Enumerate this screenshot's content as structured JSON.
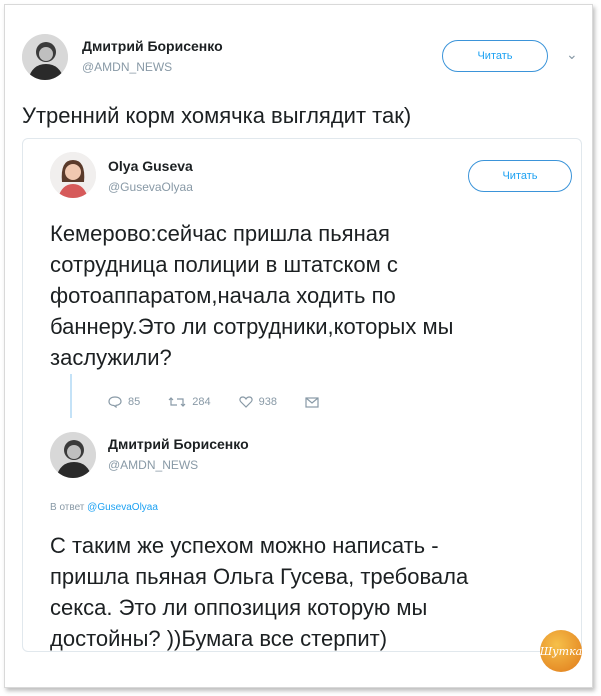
{
  "tweet": {
    "author_name": "Дмитрий Борисенко",
    "author_handle": "@AMDN_NEWS",
    "follow_label": "Читать",
    "text": "Утренний корм хомячка выглядит так)"
  },
  "quoted": {
    "author_name": "Olya Guseva",
    "author_handle": "@GusevaOlyaa",
    "follow_label": "Читать",
    "text_lines": [
      "Кемерово:сейчас пришла пьяная",
      "сотрудница полиции в штатском с",
      "фотоаппаратом,начала ходить по",
      "баннеру.Это ли сотрудники,которых мы",
      "заслужили?"
    ],
    "replies": "85",
    "retweets": "284",
    "likes": "938"
  },
  "reply": {
    "author_name": "Дмитрий Борисенко",
    "author_handle": "@AMDN_NEWS",
    "reply_to_prefix": "В ответ",
    "reply_to_handle": "@GusevaOlyaa",
    "text_lines": [
      "С таким же успехом можно написать -",
      "пришла пьяная Ольга Гусева, требовала",
      "секса. Это ли оппозиция которую мы",
      "достойны? ))Бумага все стерпит)"
    ]
  },
  "watermark_text": "Шутка",
  "colors": {
    "link": "#1da1f2",
    "muted": "#8899a6",
    "text": "#1c2022"
  }
}
